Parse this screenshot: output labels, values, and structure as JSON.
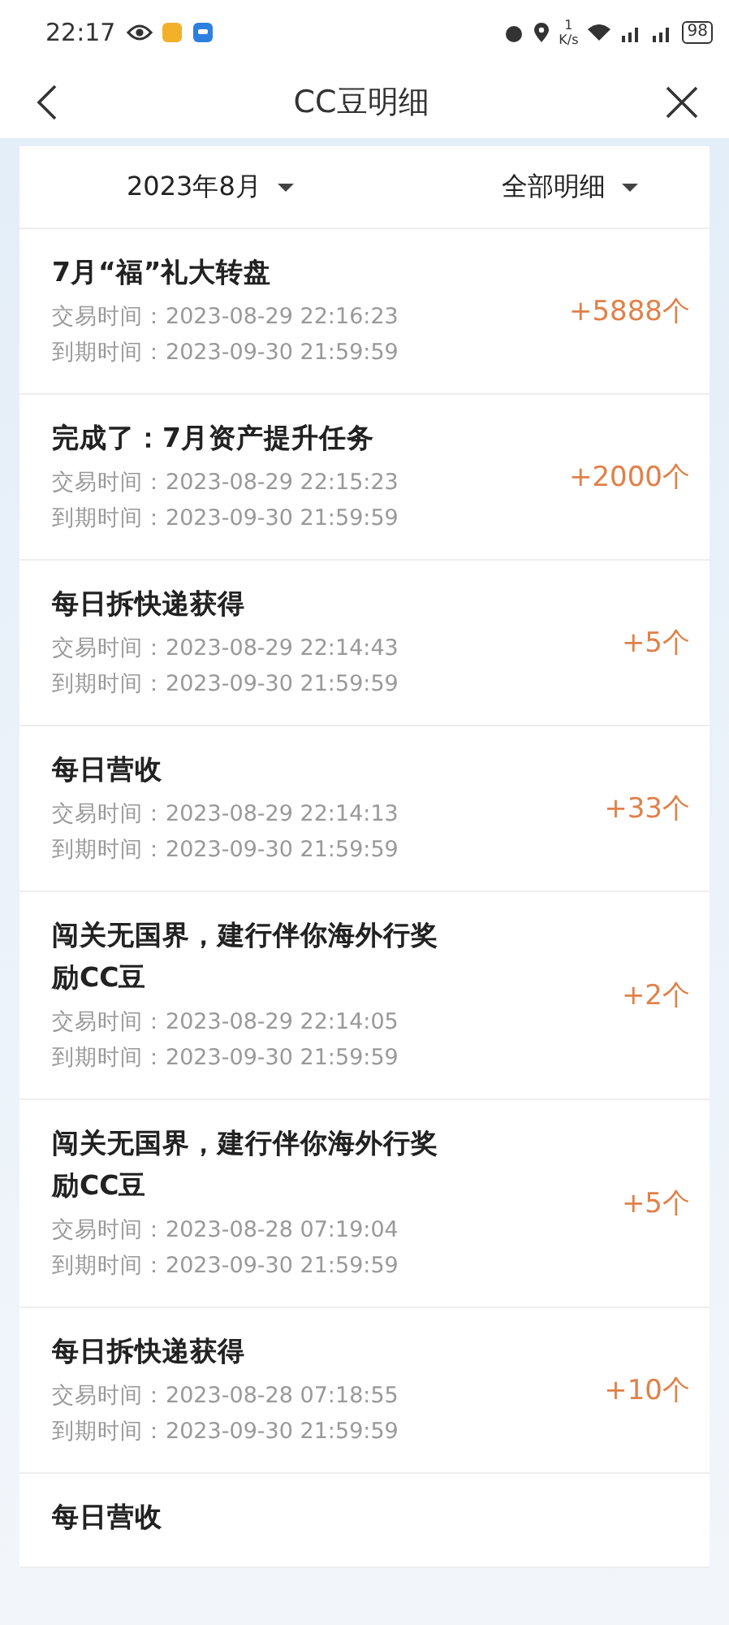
{
  "status_bar": {
    "time": "22:17",
    "net_speed_value": "1",
    "net_speed_unit": "K/s",
    "battery": "98"
  },
  "header": {
    "title": "CC豆明细"
  },
  "filters": [
    {
      "label": "2023年8月"
    },
    {
      "label": "全部明细"
    }
  ],
  "records": [
    {
      "title": "7月“福”礼大转盘",
      "trade_time": "交易时间：2023-08-29 22:16:23",
      "expire_time": "到期时间：2023-09-30 21:59:59",
      "amount": "+5888个"
    },
    {
      "title": "完成了：7月资产提升任务",
      "trade_time": "交易时间：2023-08-29 22:15:23",
      "expire_time": "到期时间：2023-09-30 21:59:59",
      "amount": "+2000个"
    },
    {
      "title": "每日拆快递获得",
      "trade_time": "交易时间：2023-08-29 22:14:43",
      "expire_time": "到期时间：2023-09-30 21:59:59",
      "amount": "+5个"
    },
    {
      "title": "每日营收",
      "trade_time": "交易时间：2023-08-29 22:14:13",
      "expire_time": "到期时间：2023-09-30 21:59:59",
      "amount": "+33个"
    },
    {
      "title": "闯关无国界，建行伴你海外行奖励CC豆",
      "trade_time": "交易时间：2023-08-29 22:14:05",
      "expire_time": "到期时间：2023-09-30 21:59:59",
      "amount": "+2个"
    },
    {
      "title": "闯关无国界，建行伴你海外行奖励CC豆",
      "trade_time": "交易时间：2023-08-28 07:19:04",
      "expire_time": "到期时间：2023-09-30 21:59:59",
      "amount": "+5个"
    },
    {
      "title": "每日拆快递获得",
      "trade_time": "交易时间：2023-08-28 07:18:55",
      "expire_time": "到期时间：2023-09-30 21:59:59",
      "amount": "+10个"
    },
    {
      "title": "每日营收"
    }
  ]
}
